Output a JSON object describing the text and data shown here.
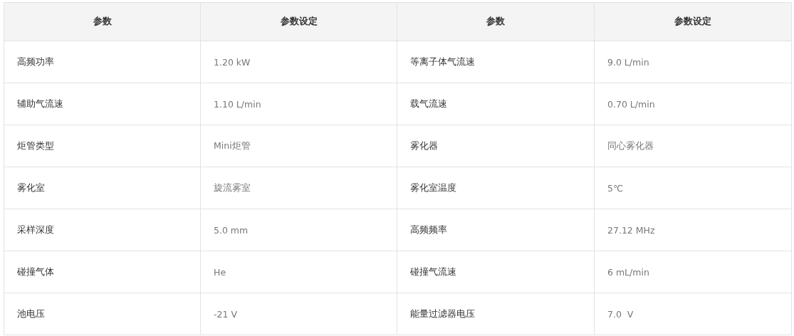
{
  "table": {
    "columns": [
      "参数",
      "参数设定",
      "参数",
      "参数设定"
    ],
    "rows": [
      [
        "高频功率",
        "1.20 kW",
        "等离子体气流速",
        "9.0 L/min"
      ],
      [
        "辅助气流速",
        "1.10 L/min",
        "载气流速",
        "0.70 L/min"
      ],
      [
        "炬管类型",
        "Mini炬管",
        "雾化器",
        "同心雾化器"
      ],
      [
        "雾化室",
        "旋流雾室",
        "雾化室温度",
        "5℃"
      ],
      [
        "采样深度",
        "5.0 mm",
        "高频频率",
        "27.12 MHz"
      ],
      [
        "碰撞气体",
        "He",
        "碰撞气流速",
        "6 mL/min"
      ],
      [
        "池电压",
        "-21 V",
        "能量过滤器电压",
        "7.0  V"
      ]
    ]
  }
}
